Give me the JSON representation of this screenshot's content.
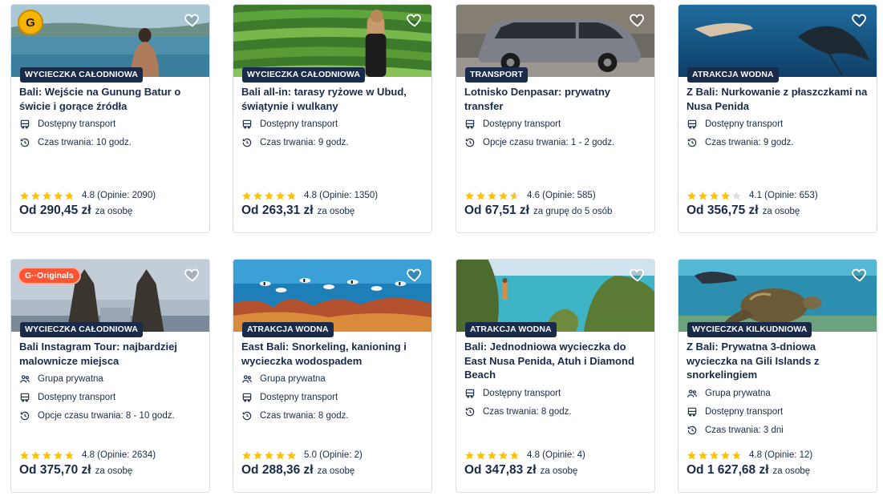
{
  "cards": [
    {
      "category": "WYCIECZKA CAŁODNIOWA",
      "title": "Bali: Wejście na Gunung Batur o świcie i gorące źródła",
      "features": [
        {
          "icon": "bus-icon",
          "text": "Dostępny transport"
        },
        {
          "icon": "clock-icon",
          "text": "Czas trwania: 10 godz."
        }
      ],
      "rating": 4.8,
      "rating_text": "4.8 (Opinie: 2090)",
      "price": "Od 290,45 zł",
      "per": "za osobę",
      "badge": "G",
      "image": "infinity-pool-lake"
    },
    {
      "category": "WYCIECZKA CAŁODNIOWA",
      "title": "Bali all-in: tarasy ryżowe w Ubud, świątynie i wulkany",
      "features": [
        {
          "icon": "bus-icon",
          "text": "Dostępny transport"
        },
        {
          "icon": "clock-icon",
          "text": "Czas trwania: 9 godz."
        }
      ],
      "rating": 4.8,
      "rating_text": "4.8 (Opinie: 1350)",
      "price": "Od 263,31 zł",
      "per": "za osobę",
      "image": "rice-terraces"
    },
    {
      "category": "TRANSPORT",
      "title": "Lotnisko Denpasar: prywatny transfer",
      "features": [
        {
          "icon": "bus-icon",
          "text": "Dostępny transport"
        },
        {
          "icon": "clock-icon",
          "text": "Opcje czasu trwania: 1 - 2 godz."
        }
      ],
      "rating": 4.6,
      "rating_text": "4.6 (Opinie: 585)",
      "price": "Od 67,51 zł",
      "per": "za grupę do 5 osób",
      "image": "silver-minivan"
    },
    {
      "category": "ATRAKCJA WODNA",
      "title": "Z Bali: Nurkowanie z płaszczkami na Nusa Penida",
      "features": [
        {
          "icon": "bus-icon",
          "text": "Dostępny transport"
        },
        {
          "icon": "clock-icon",
          "text": "Czas trwania: 9 godz."
        }
      ],
      "rating": 4.1,
      "rating_text": "4.1 (Opinie: 653)",
      "price": "Od 356,75 zł",
      "per": "za osobę",
      "image": "manta-snorkel"
    },
    {
      "category": "WYCIECZKA CAŁODNIOWA",
      "title": "Bali Instagram Tour: najbardziej malownicze miejsca",
      "features": [
        {
          "icon": "group-icon",
          "text": "Grupa prywatna"
        },
        {
          "icon": "bus-icon",
          "text": "Dostępny transport"
        },
        {
          "icon": "clock-icon",
          "text": "Opcje czasu trwania: 8 - 10 godz."
        }
      ],
      "rating": 4.8,
      "rating_text": "4.8 (Opinie: 2634)",
      "price": "Od 375,70 zł",
      "per": "za osobę",
      "badge": "G··Originals",
      "image": "temple-gate"
    },
    {
      "category": "ATRAKCJA WODNA",
      "title": "East Bali: Snorkeling, kanioning i wycieczka wodospadem",
      "features": [
        {
          "icon": "group-icon",
          "text": "Grupa prywatna"
        },
        {
          "icon": "bus-icon",
          "text": "Dostępny transport"
        },
        {
          "icon": "clock-icon",
          "text": "Czas trwania: 8 godz."
        }
      ],
      "rating": 5.0,
      "rating_text": "5.0 (Opinie: 2)",
      "price": "Od 288,36 zł",
      "per": "za osobę",
      "image": "coral-reef"
    },
    {
      "category": "ATRAKCJA WODNA",
      "title": "Bali: Jednodniowa wycieczka do East Nusa Penida, Atuh i Diamond Beach",
      "features": [
        {
          "icon": "bus-icon",
          "text": "Dostępny transport"
        },
        {
          "icon": "clock-icon",
          "text": "Czas trwania: 8 godz."
        }
      ],
      "rating": 4.8,
      "rating_text": "4.8 (Opinie: 4)",
      "price": "Od 347,83 zł",
      "per": "za osobę",
      "image": "cliff-beach"
    },
    {
      "category": "WYCIECZKA KILKUDNIOWA",
      "title": "Z Bali: Prywatna 3-dniowa wycieczka na Gili Islands z snorkelingiem",
      "features": [
        {
          "icon": "group-icon",
          "text": "Grupa prywatna"
        },
        {
          "icon": "bus-icon",
          "text": "Dostępny transport"
        },
        {
          "icon": "clock-icon",
          "text": "Czas trwania: 3 dni"
        }
      ],
      "rating": 4.8,
      "rating_text": "4.8 (Opinie: 12)",
      "price": "Od 1 627,68 zł",
      "per": "za osobę",
      "image": "sea-turtle"
    }
  ],
  "colors": {
    "navy": "#1a2b49",
    "star": "#ffc200",
    "originals": "#ff5533",
    "border": "#dcdfe4"
  }
}
